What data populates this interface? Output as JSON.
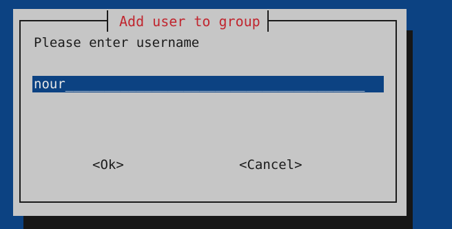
{
  "dialog": {
    "title": "Add user to group",
    "prompt": "Please enter username",
    "input": {
      "value": "nour",
      "fill": "______________________________________"
    },
    "buttons": {
      "ok_label": "<Ok>",
      "cancel_label": "<Cancel>"
    }
  },
  "colors": {
    "background": "#0c4282",
    "dialog": "#c6c6c6",
    "title": "#c0262f",
    "input_bg": "#0c4282",
    "shadow": "#171717"
  }
}
